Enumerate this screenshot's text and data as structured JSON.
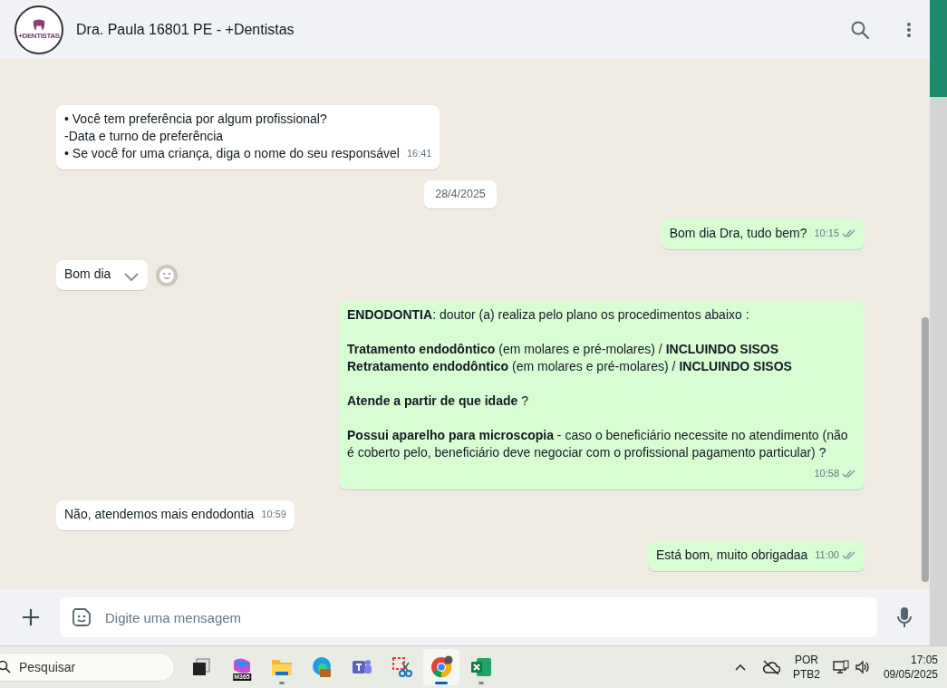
{
  "header": {
    "logo_text": "+DENTISTAS",
    "title": "Dra. Paula 16801 PE - +Dentistas"
  },
  "messages": [
    {
      "kind": "incoming",
      "paragraphs": [
        [
          "• Você tem preferência por algum profissional?",
          "-Data e turno de preferência",
          "• Se você for uma criança, diga o nome do seu responsável"
        ]
      ],
      "time": "16:41"
    },
    {
      "kind": "date",
      "text": "28/4/2025"
    },
    {
      "kind": "outgoing",
      "paragraphs": [
        [
          "Bom dia Dra, tudo bem?"
        ]
      ],
      "time": "10:15",
      "read": false
    },
    {
      "kind": "incoming",
      "paragraphs": [
        [
          "Bom dia"
        ]
      ],
      "hovered": true
    },
    {
      "kind": "outgoing",
      "paragraphs": [
        [
          "**ENDODONTIA**:  doutor (a) realiza pelo plano os procedimentos abaixo :"
        ],
        [
          "**Tratamento endodôntico** (em molares e pré-molares) / **INCLUINDO SISOS**",
          "**Retratamento endodôntico** (em molares e pré-molares) / **INCLUINDO SISOS**"
        ],
        [
          "**Atende a partir de que idade**  ?"
        ],
        [
          "**Possui aparelho para microscopia** - caso o beneficiário necessite no atendimento (não é coberto pelo, beneficiário deve negociar com o profissional pagamento particular)  ?"
        ]
      ],
      "time": "10:58",
      "read": false
    },
    {
      "kind": "incoming",
      "paragraphs": [
        [
          "Não, atendemos mais endodontia"
        ]
      ],
      "time": "10:59"
    },
    {
      "kind": "outgoing",
      "paragraphs": [
        [
          "Está bom, muito obrigadaa"
        ]
      ],
      "time": "11:00",
      "read": false
    }
  ],
  "composer": {
    "placeholder": "Digite uma mensagem"
  },
  "taskbar": {
    "search_placeholder": "Pesquisar",
    "apps": [
      {
        "kind": "taskview",
        "running": false,
        "active": false
      },
      {
        "kind": "m365",
        "badge": "M365",
        "running": false,
        "active": false
      },
      {
        "kind": "files",
        "running": true,
        "active": false
      },
      {
        "kind": "edge",
        "running": false,
        "active": false
      },
      {
        "kind": "teams",
        "running": false,
        "active": false
      },
      {
        "kind": "snip",
        "running": false,
        "active": false
      },
      {
        "kind": "chrome",
        "running": true,
        "active": true
      },
      {
        "kind": "excel",
        "running": true,
        "active": false
      }
    ],
    "language": "POR",
    "layout": "PTB2",
    "time": "17:05",
    "date": "09/05/2025"
  }
}
